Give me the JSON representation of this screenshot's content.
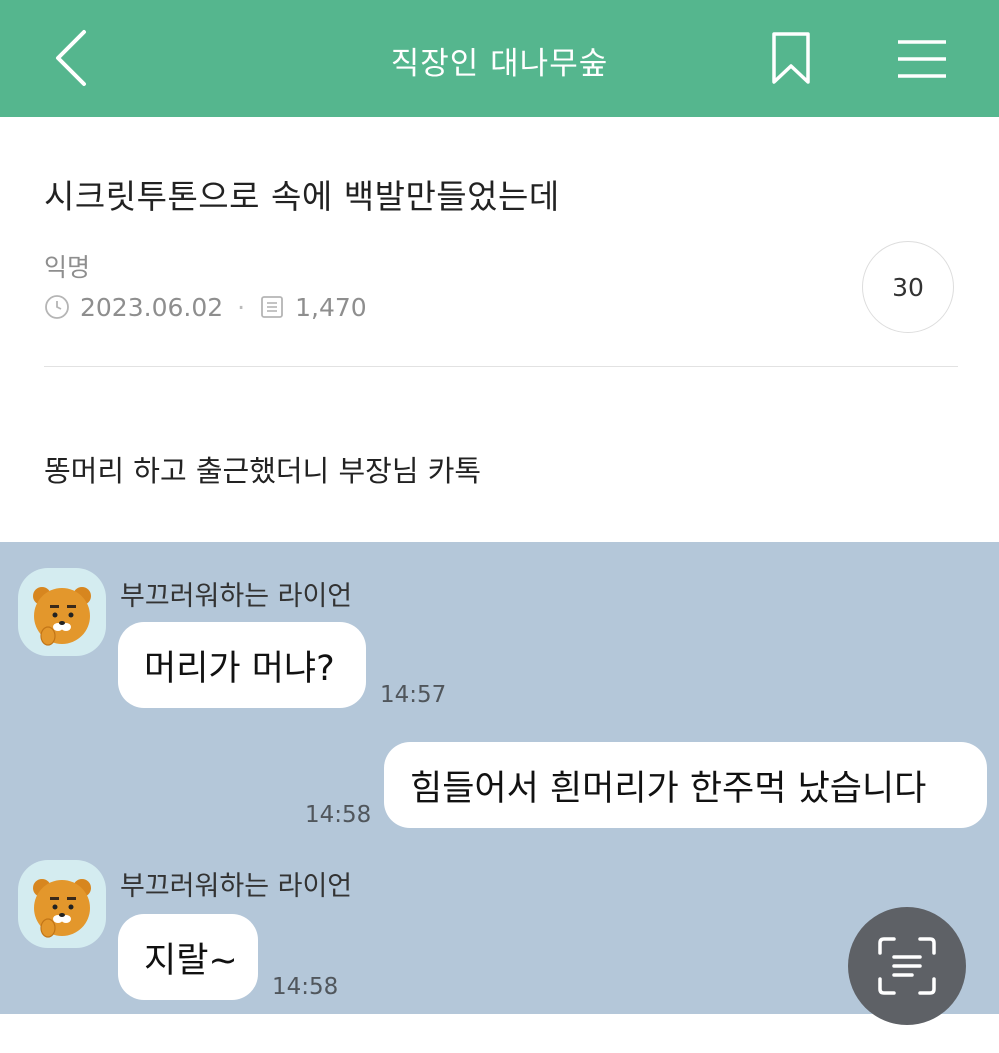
{
  "header": {
    "title": "직장인 대나무숲",
    "icons": {
      "back": "chevron-left-icon",
      "bookmark": "bookmark-icon",
      "menu": "hamburger-menu-icon"
    }
  },
  "post": {
    "title": "시크릿투톤으로 속에 백발만들었는데",
    "author": "익명",
    "date": "2023.06.02",
    "views": "1,470",
    "comment_count": "30",
    "body": "똥머리 하고 출근했더니 부장님 카톡"
  },
  "chat": {
    "background": "#b4c7d9",
    "messages": [
      {
        "sender": "부끄러워하는 라이언",
        "text": "머리가 머냐?",
        "time": "14:57"
      },
      {
        "text": "힘들어서 흰머리가 한주먹 났습니다",
        "time": "14:58"
      },
      {
        "sender": "부끄러워하는 라이언",
        "text": "지랄~",
        "time": "14:58"
      }
    ]
  },
  "colors": {
    "brand": "#55b68e",
    "chat_bg": "#b4c7d9",
    "scan_button": "#5e6166"
  }
}
